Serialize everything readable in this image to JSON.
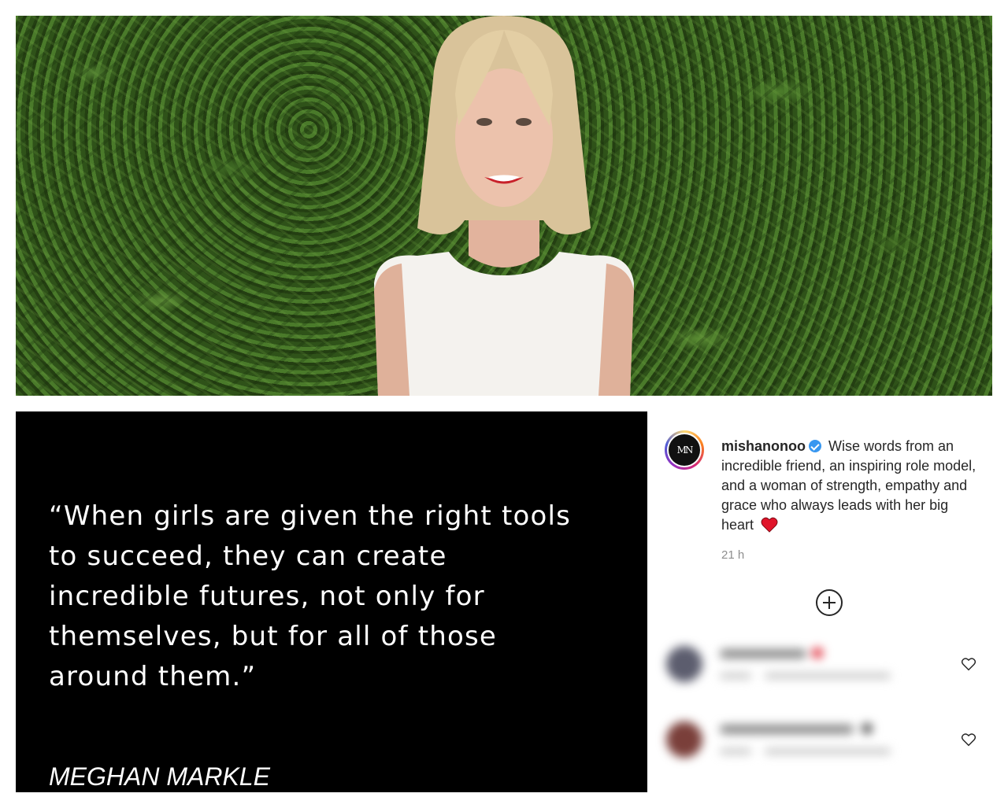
{
  "quote": {
    "text": "“When girls are given the right tools\nto succeed, they can create\nincredible futures, not only for\nthemselves, but for all of those\naround them.”",
    "author": "MEGHAN MARKLE"
  },
  "post": {
    "avatar_monogram": "MN",
    "username": "mishanonoo",
    "verified": true,
    "caption": "Wise words from an incredible friend, an inspiring role model, and a woman of strength, empathy and grace who always leads with her big heart",
    "timestamp": "21 h"
  },
  "icons": {
    "verified": "verified-badge-icon",
    "heart_emoji": "red-heart-emoji-icon",
    "load_more": "plus-circle-icon",
    "like": "heart-outline-icon"
  },
  "comments": [
    {
      "blurred": true,
      "avatar_color": "#5c5d6e"
    },
    {
      "blurred": true,
      "avatar_color": "#7a3f3a"
    }
  ],
  "colors": {
    "quote_background": "#000000",
    "verified_blue": "#3897f0",
    "text_dark": "#262626",
    "text_muted": "#8e8e8e"
  }
}
